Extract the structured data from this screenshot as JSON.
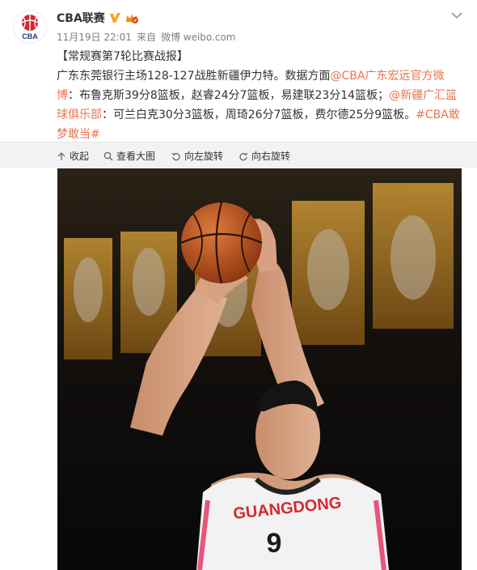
{
  "author": {
    "name": "CBA联赛",
    "logo_text": "CBA"
  },
  "meta": {
    "time": "11月19日 22:01",
    "from_prefix": "来自",
    "source": "微博 weibo.com"
  },
  "post": {
    "line1": "【常规赛第7轮比赛战报】",
    "seg_a": "广东东莞银行主场128-127战胜新疆伊力特。数据方面",
    "mention_guangdong": "@CBA广东宏远官方微博",
    "seg_b": "：布鲁克斯39分8篮板，赵睿24分7篮板，易建联23分14篮板；",
    "mention_xinjiang": "@新疆广汇篮球俱乐部",
    "seg_c": "：可兰白克30分3篮板，周琦26分7篮板，费尔德25分9篮板。",
    "hashtag": "#CBA敢梦敢当#"
  },
  "toolbar": {
    "collapse": "收起",
    "view_large": "查看大图",
    "rotate_left": "向左旋转",
    "rotate_right": "向右旋转"
  },
  "photo": {
    "jersey_text": "GUANGDONG",
    "jersey_number": "9"
  },
  "colors": {
    "link": "#eb7350",
    "logo_red": "#d6282e",
    "verified": "#ffa31a",
    "toolbar_bg": "#f2f2f5"
  }
}
